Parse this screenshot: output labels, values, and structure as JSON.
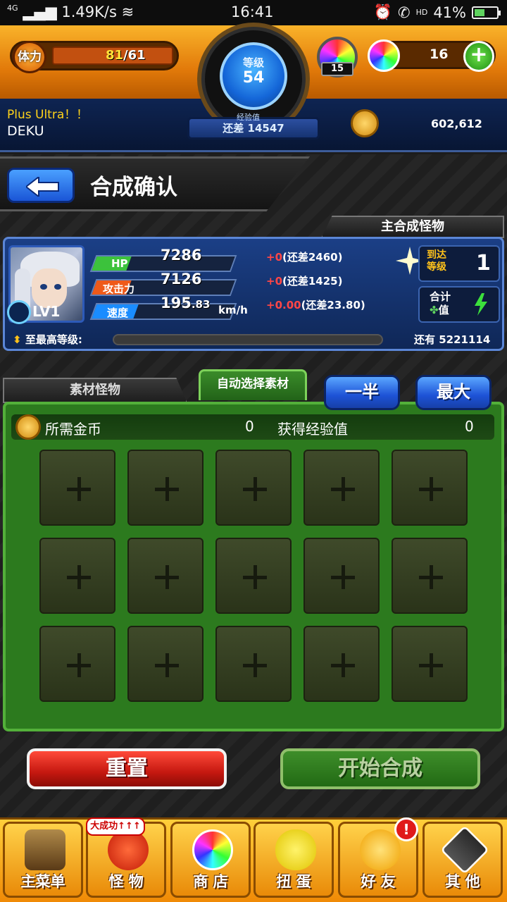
{
  "status_bar": {
    "network": "4G",
    "speed": "1.49K/s",
    "time": "16:41",
    "battery": "41%",
    "hd": "HD"
  },
  "header": {
    "stamina_label": "体力",
    "stamina_current": "81",
    "stamina_max": "/61",
    "level_label": "等级",
    "level_value": "54",
    "exp_title": "经验值",
    "exp_remaining": "还差 14547",
    "gem_count": "15",
    "orb_count": "16",
    "player_title": "Plus Ultra！！",
    "player_name": "DEKU",
    "coins": "602,612"
  },
  "page": {
    "title": "合成确认"
  },
  "main_monster": {
    "section_label": "主合成怪物",
    "level_text": "LV1",
    "stats": [
      {
        "label": "HP",
        "value": "7286",
        "diff_plus": "+0",
        "diff_rest": "(还差2460)",
        "fill": 0.25,
        "color": "#3cc23c"
      },
      {
        "label": "攻击力",
        "value": "7126",
        "diff_plus": "+0",
        "diff_rest": "(还差1425)",
        "fill": 0.25,
        "color": "#ef5a1a"
      },
      {
        "label": "速度",
        "value": "195",
        "value_decimal": ".83",
        "unit": "km/h",
        "diff_plus": "+0.00",
        "diff_rest": "(还差23.80)",
        "fill": 0.3,
        "color": "#1a8cff"
      }
    ],
    "reach_label_line1": "到达",
    "reach_label_line2": "等级",
    "reach_value": "1",
    "total_label_line1": "合计",
    "total_label_line2": "值",
    "max_level_label": "至最高等级:",
    "remaining_label": "还有 5221114"
  },
  "materials": {
    "tab_label": "素材怪物",
    "auto_select_label": "自动选择素材",
    "half_button": "一半",
    "max_button": "最大",
    "gold_label": "所需金币",
    "gold_value": "0",
    "exp_label": "获得经验值",
    "exp_value": "0",
    "slot_count": 15
  },
  "actions": {
    "reset": "重置",
    "start": "开始合成"
  },
  "nav": {
    "items": [
      {
        "label": "主菜单",
        "icon": "main-menu-icon"
      },
      {
        "label": "怪 物",
        "icon": "monster-icon"
      },
      {
        "label": "商 店",
        "icon": "shop-orb-icon"
      },
      {
        "label": "扭 蛋",
        "icon": "gacha-egg-icon"
      },
      {
        "label": "好 友",
        "icon": "friends-icon"
      },
      {
        "label": "其 他",
        "icon": "other-icon"
      }
    ],
    "monster_badge": "大成功↑↑↑",
    "friends_alert": "!"
  },
  "colors": {
    "accent_orange": "#f9b32a",
    "panel_blue": "#1b3f86",
    "panel_green": "#2c7a1e",
    "reset_red": "#c51810",
    "start_green": "#226a14"
  }
}
